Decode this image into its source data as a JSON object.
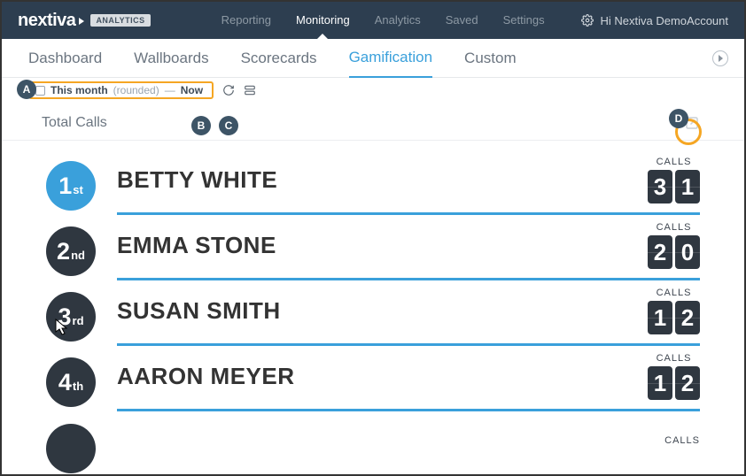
{
  "brand": {
    "name": "nextiva",
    "badge": "ANALYTICS"
  },
  "topnav": {
    "items": [
      "Reporting",
      "Monitoring",
      "Analytics",
      "Saved",
      "Settings"
    ],
    "active_index": 1
  },
  "account": {
    "greeting": "Hi Nextiva DemoAccount"
  },
  "subnav": {
    "tabs": [
      "Dashboard",
      "Wallboards",
      "Scorecards",
      "Gamification",
      "Custom"
    ],
    "active_index": 3
  },
  "toolbar": {
    "date_range": {
      "start_label": "This month",
      "start_qualifier": "(rounded)",
      "separator": "—",
      "end_label": "Now"
    }
  },
  "section": {
    "title": "Total Calls",
    "score_label": "CALLS"
  },
  "leaderboard": [
    {
      "rank_num": "1",
      "rank_suffix": "st",
      "name": "BETTY WHITE",
      "digits": [
        "3",
        "1"
      ]
    },
    {
      "rank_num": "2",
      "rank_suffix": "nd",
      "name": "EMMA STONE",
      "digits": [
        "2",
        "0"
      ]
    },
    {
      "rank_num": "3",
      "rank_suffix": "rd",
      "name": "SUSAN SMITH",
      "digits": [
        "1",
        "2"
      ]
    },
    {
      "rank_num": "4",
      "rank_suffix": "th",
      "name": "AARON MEYER",
      "digits": [
        "1",
        "2"
      ]
    }
  ],
  "annotations": {
    "A": "A",
    "B": "B",
    "C": "C",
    "D": "D"
  }
}
